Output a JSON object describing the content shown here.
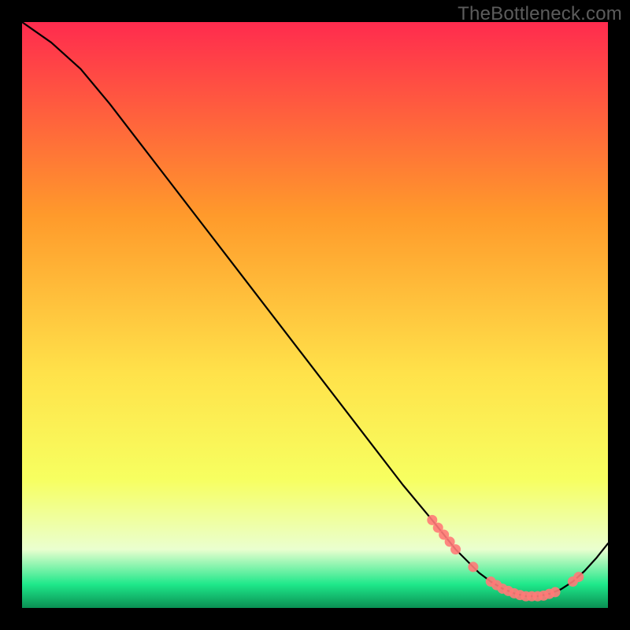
{
  "watermark": "TheBottleneck.com",
  "colors": {
    "background": "#000000",
    "gradient_top": "#ff2b4e",
    "gradient_low_yellow": "#f7ff60",
    "gradient_pale": "#eaffcf",
    "gradient_green": "#1ee88a",
    "gradient_bottom": "#0a8f53",
    "curve": "#000000",
    "marker": "#ff7a78",
    "watermark": "#5c5c5c"
  },
  "chart_data": {
    "type": "line",
    "title": "",
    "xlabel": "",
    "ylabel": "",
    "xlim": [
      0,
      100
    ],
    "ylim": [
      0,
      100
    ],
    "grid": false,
    "legend": false,
    "series": [
      {
        "name": "bottleneck-curve",
        "x": [
          0,
          5,
          10,
          15,
          20,
          25,
          30,
          35,
          40,
          45,
          50,
          55,
          60,
          65,
          70,
          72,
          74,
          76,
          78,
          80,
          82,
          84,
          86,
          88,
          90,
          92,
          94,
          96,
          98,
          100
        ],
        "y": [
          100,
          96.5,
          92,
          86,
          79.5,
          73,
          66.5,
          60,
          53.5,
          47,
          40.5,
          34,
          27.5,
          21,
          15,
          12.5,
          10,
          8,
          6,
          4.5,
          3.3,
          2.5,
          2,
          2,
          2.4,
          3.2,
          4.5,
          6.3,
          8.5,
          11
        ]
      }
    ],
    "markers": {
      "name": "highlighted-points",
      "x": [
        70,
        71,
        72,
        73,
        74,
        77,
        80,
        81,
        82,
        83,
        84,
        85,
        86,
        87,
        88,
        89,
        90,
        91,
        94,
        95
      ],
      "y": [
        15,
        13.7,
        12.5,
        11.3,
        10,
        7,
        4.5,
        3.9,
        3.3,
        2.9,
        2.5,
        2.2,
        2,
        2,
        2,
        2.1,
        2.4,
        2.7,
        4.5,
        5.3
      ]
    }
  }
}
